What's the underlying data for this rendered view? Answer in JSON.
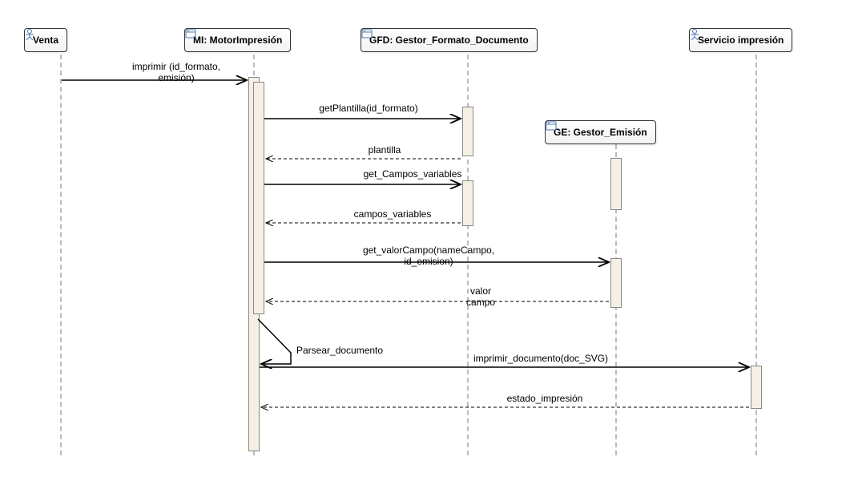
{
  "participants": {
    "venta": "Venta",
    "mi": "MI: MotorImpresión",
    "gfd": "GFD: Gestor_Formato_Documento",
    "ge": "GE: Gestor_Emisión",
    "servicio": "Servicio impresión"
  },
  "messages": {
    "m1": "imprimir (id_formato,\nemisión)",
    "m2": "getPlantilla(id_formato)",
    "r2": "plantilla",
    "m3": "get_Campos_variables",
    "r3": "campos_variables",
    "m4": "get_valorCampo(nameCampo,\nid_emision)",
    "r4": "valor\ncampo",
    "self": "Parsear_documento",
    "m5": "imprimir_documento(doc_SVG)",
    "r5": "estado_impresión"
  },
  "chart_data": {
    "type": "sequence_diagram",
    "participants": [
      {
        "name": "Venta",
        "type": "actor"
      },
      {
        "name": "MI: MotorImpresión",
        "type": "object"
      },
      {
        "name": "GFD: Gestor_Formato_Documento",
        "type": "object"
      },
      {
        "name": "GE: Gestor_Emisión",
        "type": "object"
      },
      {
        "name": "Servicio impresión",
        "type": "actor"
      }
    ],
    "messages": [
      {
        "from": "Venta",
        "to": "MI: MotorImpresión",
        "label": "imprimir (id_formato, emisión)",
        "kind": "call"
      },
      {
        "from": "MI: MotorImpresión",
        "to": "GFD: Gestor_Formato_Documento",
        "label": "getPlantilla(id_formato)",
        "kind": "call"
      },
      {
        "from": "GFD: Gestor_Formato_Documento",
        "to": "MI: MotorImpresión",
        "label": "plantilla",
        "kind": "return"
      },
      {
        "from": "MI: MotorImpresión",
        "to": "GFD: Gestor_Formato_Documento",
        "label": "get_Campos_variables",
        "kind": "call"
      },
      {
        "from": "GFD: Gestor_Formato_Documento",
        "to": "MI: MotorImpresión",
        "label": "campos_variables",
        "kind": "return"
      },
      {
        "from": "MI: MotorImpresión",
        "to": "GE: Gestor_Emisión",
        "label": "get_valorCampo(nameCampo, id_emision)",
        "kind": "call"
      },
      {
        "from": "GE: Gestor_Emisión",
        "to": "MI: MotorImpresión",
        "label": "valor campo",
        "kind": "return"
      },
      {
        "from": "MI: MotorImpresión",
        "to": "MI: MotorImpresión",
        "label": "Parsear_documento",
        "kind": "self"
      },
      {
        "from": "MI: MotorImpresión",
        "to": "Servicio impresión",
        "label": "imprimir_documento(doc_SVG)",
        "kind": "call"
      },
      {
        "from": "Servicio impresión",
        "to": "MI: MotorImpresión",
        "label": "estado_impresión",
        "kind": "return"
      }
    ]
  }
}
